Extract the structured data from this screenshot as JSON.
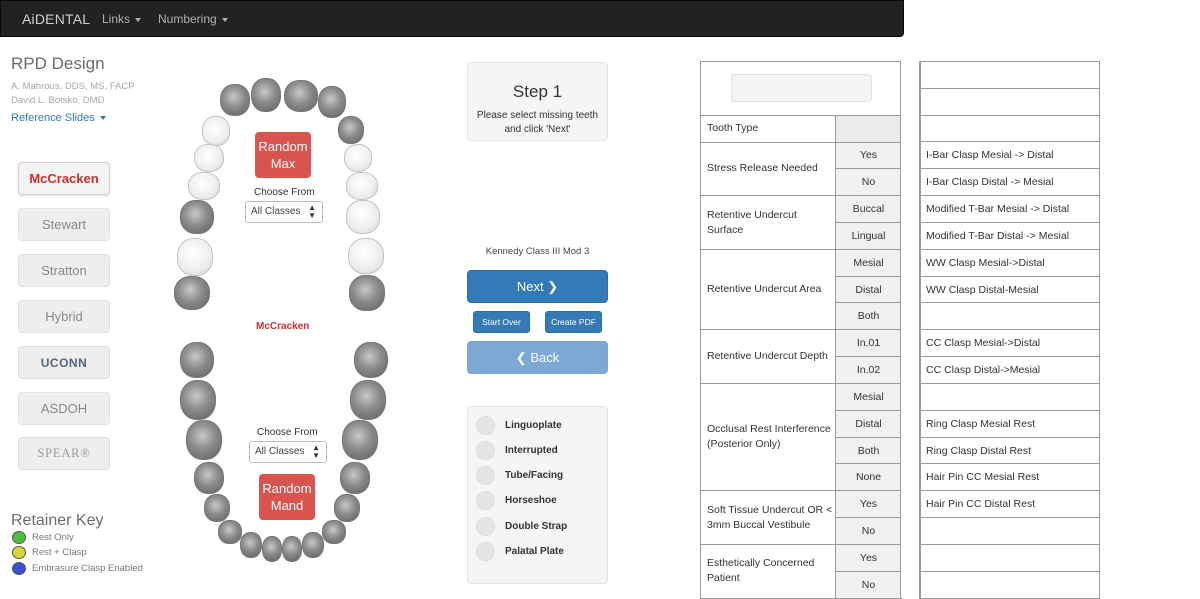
{
  "nav": {
    "brand": "AiDENTAL",
    "links_label": "Links",
    "numbering_label": "Numbering"
  },
  "left": {
    "title": "RPD Design",
    "authors": [
      "A. Mahrous, DDS, MS, FACP",
      "David L. Botsko, DMD"
    ],
    "reference_link": "Reference Slides",
    "buttons": [
      "McCracken",
      "Stewart",
      "Stratton",
      "Hybrid",
      "UCONN",
      "ASDOH",
      "SPEAR®"
    ],
    "active_button": "McCracken",
    "retainer_key": {
      "title": "Retainer Key",
      "items": [
        {
          "label": "Rest Only",
          "color": "#4fbf3b"
        },
        {
          "label": "Rest + Clasp",
          "color": "#d8d433"
        },
        {
          "label": "Embrasure Clasp Enabled",
          "color": "#3b4fd8"
        }
      ]
    }
  },
  "arch": {
    "random_max": "Random Max",
    "random_mand": "Random Mand",
    "choose_from": "Choose From",
    "select_value": "All Classes",
    "label": "McCracken"
  },
  "center": {
    "step_title": "Step 1",
    "step_text": "Please select missing teeth and click 'Next'",
    "kennedy": "Kennedy Class III Mod 3",
    "next": "Next",
    "start_over": "Start Over",
    "create_pdf": "Create PDF",
    "back": "Back",
    "options": [
      "Linguoplate",
      "Interrupted",
      "Tube/Facing",
      "Horseshoe",
      "Double Strap",
      "Palatal Plate"
    ]
  },
  "table": {
    "tooth_type": "Tooth Type",
    "stress_release": "Stress Release Needed",
    "retentive_surface": "Retentive Undercut Surface",
    "retentive_area": "Retentive Undercut Area",
    "retentive_depth": "Retentive Undercut Depth",
    "occlusal_rest": "Occlusal Rest Interference (Posterior Only)",
    "soft_tissue": "Soft Tissue Undercut OR < 3mm Buccal Vestibule",
    "esthetic": "Esthetically Concerned Patient",
    "yes": "Yes",
    "no": "No",
    "buccal": "Buccal",
    "lingual": "Lingual",
    "mesial": "Mesial",
    "distal": "Distal",
    "both": "Both",
    "none": "None",
    "in01": "In.01",
    "in02": "In.02"
  },
  "clasps": [
    "",
    "",
    "",
    "I-Bar Clasp Mesial -> Distal",
    "I-Bar Clasp Distal -> Mesial",
    "Modified T-Bar Mesial -> Distal",
    "Modified T-Bar Distal -> Mesial",
    "WW Clasp Mesial->Distal",
    "WW Clasp Distal-Mesial",
    "",
    "CC Clasp Mesial->Distal",
    "CC Clasp Distal->Mesial",
    "",
    "Ring Clasp Mesial Rest",
    "Ring Clasp Distal Rest",
    "Hair Pin CC Mesial Rest",
    "Hair Pin CC Distal Rest",
    "",
    "",
    ""
  ]
}
